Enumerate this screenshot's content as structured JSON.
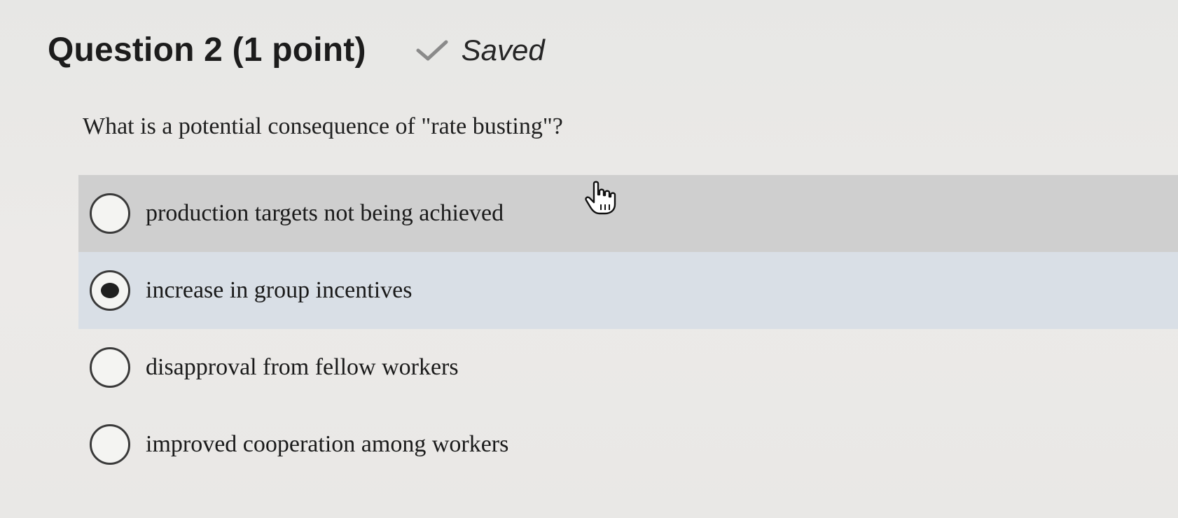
{
  "question": {
    "title": "Question 2 (1 point)",
    "status_icon": "check-icon",
    "status": "Saved",
    "prompt": "What is a potential consequence of \"rate busting\"?"
  },
  "options": [
    {
      "label": "production targets not being achieved",
      "selected": false
    },
    {
      "label": "increase in group incentives",
      "selected": true
    },
    {
      "label": "disapproval from fellow workers",
      "selected": false
    },
    {
      "label": "improved cooperation among workers",
      "selected": false
    }
  ],
  "colors": {
    "hover_bg": "#cfcfcf",
    "selected_bg": "#d9dfe6",
    "check": "#8a8a8a"
  }
}
